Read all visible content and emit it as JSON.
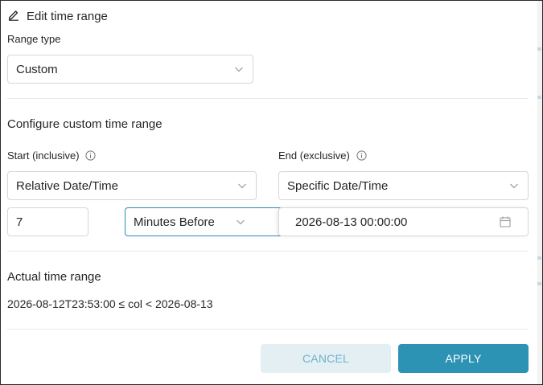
{
  "dialog": {
    "title": "Edit time range",
    "title_icon": "pencil-icon"
  },
  "range_type": {
    "label": "Range type",
    "value": "Custom"
  },
  "custom": {
    "heading": "Configure custom time range",
    "start": {
      "label": "Start (inclusive)",
      "mode": "Relative Date/Time",
      "amount": "7",
      "unit": "Minutes Before"
    },
    "end": {
      "label": "End (exclusive)",
      "mode": "Specific Date/Time",
      "datetime": "2026-08-13 00:00:00"
    }
  },
  "actual": {
    "heading": "Actual time range",
    "value": "2026-08-12T23:53:00 ≤ col < 2026-08-13"
  },
  "buttons": {
    "cancel": "CANCEL",
    "apply": "APPLY"
  },
  "colors": {
    "accent": "#2d93b5",
    "cancel_bg": "#e3eff2",
    "cancel_text": "#6fb3cc",
    "focus_border": "#2a8cb7"
  }
}
